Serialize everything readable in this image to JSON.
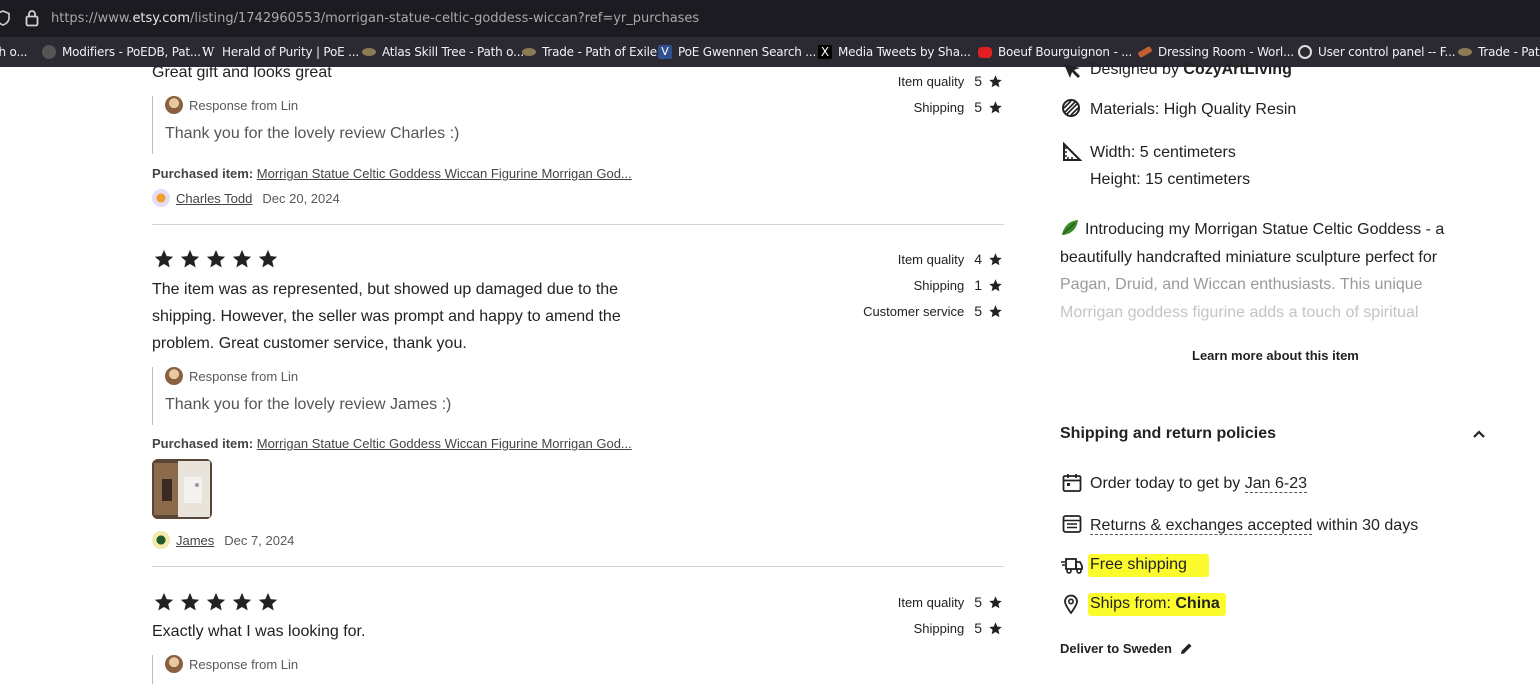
{
  "browser": {
    "url_prefix": "https://www.",
    "url_host": "etsy.com",
    "url_path": "/listing/1742960553/morrigan-statue-celtic-goddess-wiccan?ref=yr_purchases"
  },
  "bookmarks": [
    {
      "label": "th o...",
      "color": "#2b2a33"
    },
    {
      "label": "Modifiers - PoEDB, Pat...",
      "color": "#555555"
    },
    {
      "label": "Herald of Purity | PoE ...",
      "color": "#2b2a33"
    },
    {
      "label": "Atlas Skill Tree - Path o...",
      "color": "#8a7a55"
    },
    {
      "label": "Trade - Path of Exile",
      "color": "#8a7a55"
    },
    {
      "label": "PoE Gwennen Search ...",
      "color": "#2f4f8f"
    },
    {
      "label": "Media Tweets by Sha...",
      "color": "#000000"
    },
    {
      "label": "Boeuf Bourguignon - ...",
      "color": "#e02020"
    },
    {
      "label": "Dressing Room - Worl...",
      "color": "#c06030"
    },
    {
      "label": "User control panel -- F...",
      "color": "#2b2a33"
    },
    {
      "label": "Trade - Path",
      "color": "#8a7a55"
    }
  ],
  "reviews": [
    {
      "title": "Great gift and looks great",
      "ratings": [
        {
          "label": "Item quality",
          "value": "5"
        },
        {
          "label": "Shipping",
          "value": "5"
        }
      ],
      "response_from": "Response from Lin",
      "response_text": "Thank you for the lovely review Charles :)",
      "purchased_label": "Purchased item:",
      "purchased_item": "Morrigan Statue Celtic Goddess Wiccan Figurine Morrigan God...",
      "reviewer": "Charles Todd",
      "date": "Dec 20, 2024"
    },
    {
      "stars": 5,
      "text": "The item was as represented, but showed up damaged due to the shipping. However, the seller was prompt and happy to amend the problem. Great customer service, thank you.",
      "ratings": [
        {
          "label": "Item quality",
          "value": "4"
        },
        {
          "label": "Shipping",
          "value": "1"
        },
        {
          "label": "Customer service",
          "value": "5"
        }
      ],
      "response_from": "Response from Lin",
      "response_text": "Thank you for the lovely review James :)",
      "purchased_label": "Purchased item:",
      "purchased_item": "Morrigan Statue Celtic Goddess Wiccan Figurine Morrigan God...",
      "reviewer": "James",
      "date": "Dec 7, 2024"
    },
    {
      "stars": 5,
      "text": "Exactly what I was looking for.",
      "ratings": [
        {
          "label": "Item quality",
          "value": "5"
        },
        {
          "label": "Shipping",
          "value": "5"
        }
      ],
      "response_from": "Response from Lin"
    }
  ],
  "details": {
    "designed_by_prefix": "Designed by ",
    "designed_by_name": "CozyArtLiving",
    "materials": "Materials: High Quality Resin",
    "width": "Width: 5 centimeters",
    "height": "Height: 15 centimeters",
    "description_line1": "Introducing my Morrigan Statue Celtic Goddess - a",
    "description_line2": "beautifully handcrafted miniature sculpture perfect for",
    "description_line3": "Pagan, Druid, and Wiccan enthusiasts. This unique",
    "description_line4": "Morrigan goddess figurine adds a touch of spiritual",
    "learn_more": "Learn more about this item"
  },
  "policies": {
    "title": "Shipping and return policies",
    "order_prefix": "Order today to get by ",
    "order_date": "Jan 6-23",
    "returns_link": "Returns & exchanges accepted",
    "returns_suffix": " within 30 days",
    "free_shipping": "Free shipping",
    "ships_from_label": "Ships from: ",
    "ships_from_value": "China",
    "deliver_to": "Deliver to Sweden"
  },
  "colors": {
    "highlight": "#fbfb2d"
  }
}
